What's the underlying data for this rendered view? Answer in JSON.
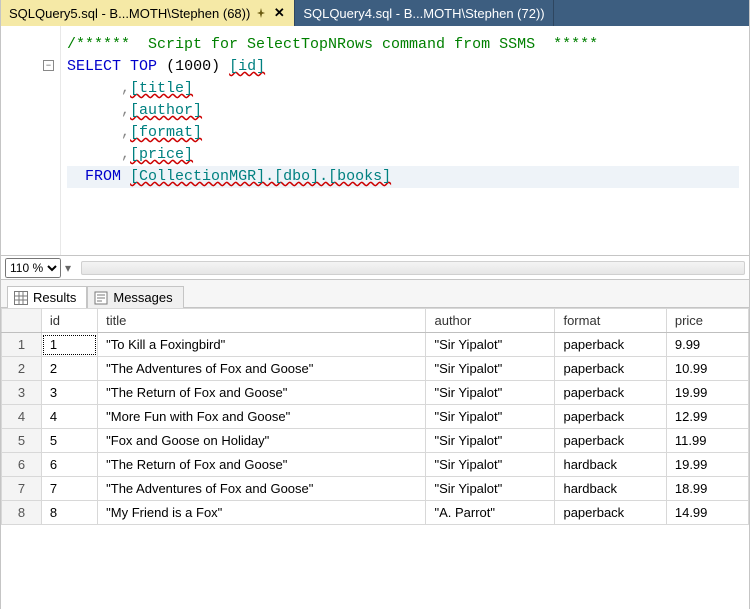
{
  "tabs": [
    {
      "label": "SQLQuery5.sql - B...MOTH\\Stephen (68))",
      "active": true,
      "pinned": true
    },
    {
      "label": "SQLQuery4.sql - B...MOTH\\Stephen (72))",
      "active": false,
      "pinned": false
    }
  ],
  "editor": {
    "comment_line": "/******  Script for SelectTopNRows command from SSMS  *****",
    "select_kw": "SELECT",
    "top_kw": "TOP",
    "top_n": "(1000)",
    "cols": {
      "id": "[id]",
      "title": "[title]",
      "author": "[author]",
      "format": "[format]",
      "price": "[price]"
    },
    "from_kw": "FROM",
    "from_target": "[CollectionMGR].[dbo].[books]",
    "comma": ",",
    "fold_glyph": "−"
  },
  "zoom": {
    "value": "110 %"
  },
  "result_tabs": {
    "results": "Results",
    "messages": "Messages"
  },
  "grid": {
    "headers": {
      "rownum": "",
      "id": "id",
      "title": "title",
      "author": "author",
      "format": "format",
      "price": "price"
    },
    "rows": [
      {
        "n": "1",
        "id": "1",
        "title": "\"To Kill a Foxingbird\"",
        "author": "\"Sir Yipalot\"",
        "format": "paperback",
        "price": "9.99"
      },
      {
        "n": "2",
        "id": "2",
        "title": "\"The Adventures of Fox and Goose\"",
        "author": "\"Sir Yipalot\"",
        "format": "paperback",
        "price": "10.99"
      },
      {
        "n": "3",
        "id": "3",
        "title": "\"The Return of Fox and Goose\"",
        "author": "\"Sir Yipalot\"",
        "format": "paperback",
        "price": "19.99"
      },
      {
        "n": "4",
        "id": "4",
        "title": "\"More Fun with Fox and Goose\"",
        "author": "\"Sir Yipalot\"",
        "format": "paperback",
        "price": "12.99"
      },
      {
        "n": "5",
        "id": "5",
        "title": "\"Fox and Goose on Holiday\"",
        "author": "\"Sir Yipalot\"",
        "format": "paperback",
        "price": "11.99"
      },
      {
        "n": "6",
        "id": "6",
        "title": "\"The Return of Fox and Goose\"",
        "author": "\"Sir Yipalot\"",
        "format": "hardback",
        "price": "19.99"
      },
      {
        "n": "7",
        "id": "7",
        "title": "\"The Adventures of Fox and Goose\"",
        "author": "\"Sir Yipalot\"",
        "format": "hardback",
        "price": "18.99"
      },
      {
        "n": "8",
        "id": "8",
        "title": "\"My Friend is a Fox\"",
        "author": "\"A. Parrot\"",
        "format": "paperback",
        "price": "14.99"
      }
    ]
  }
}
